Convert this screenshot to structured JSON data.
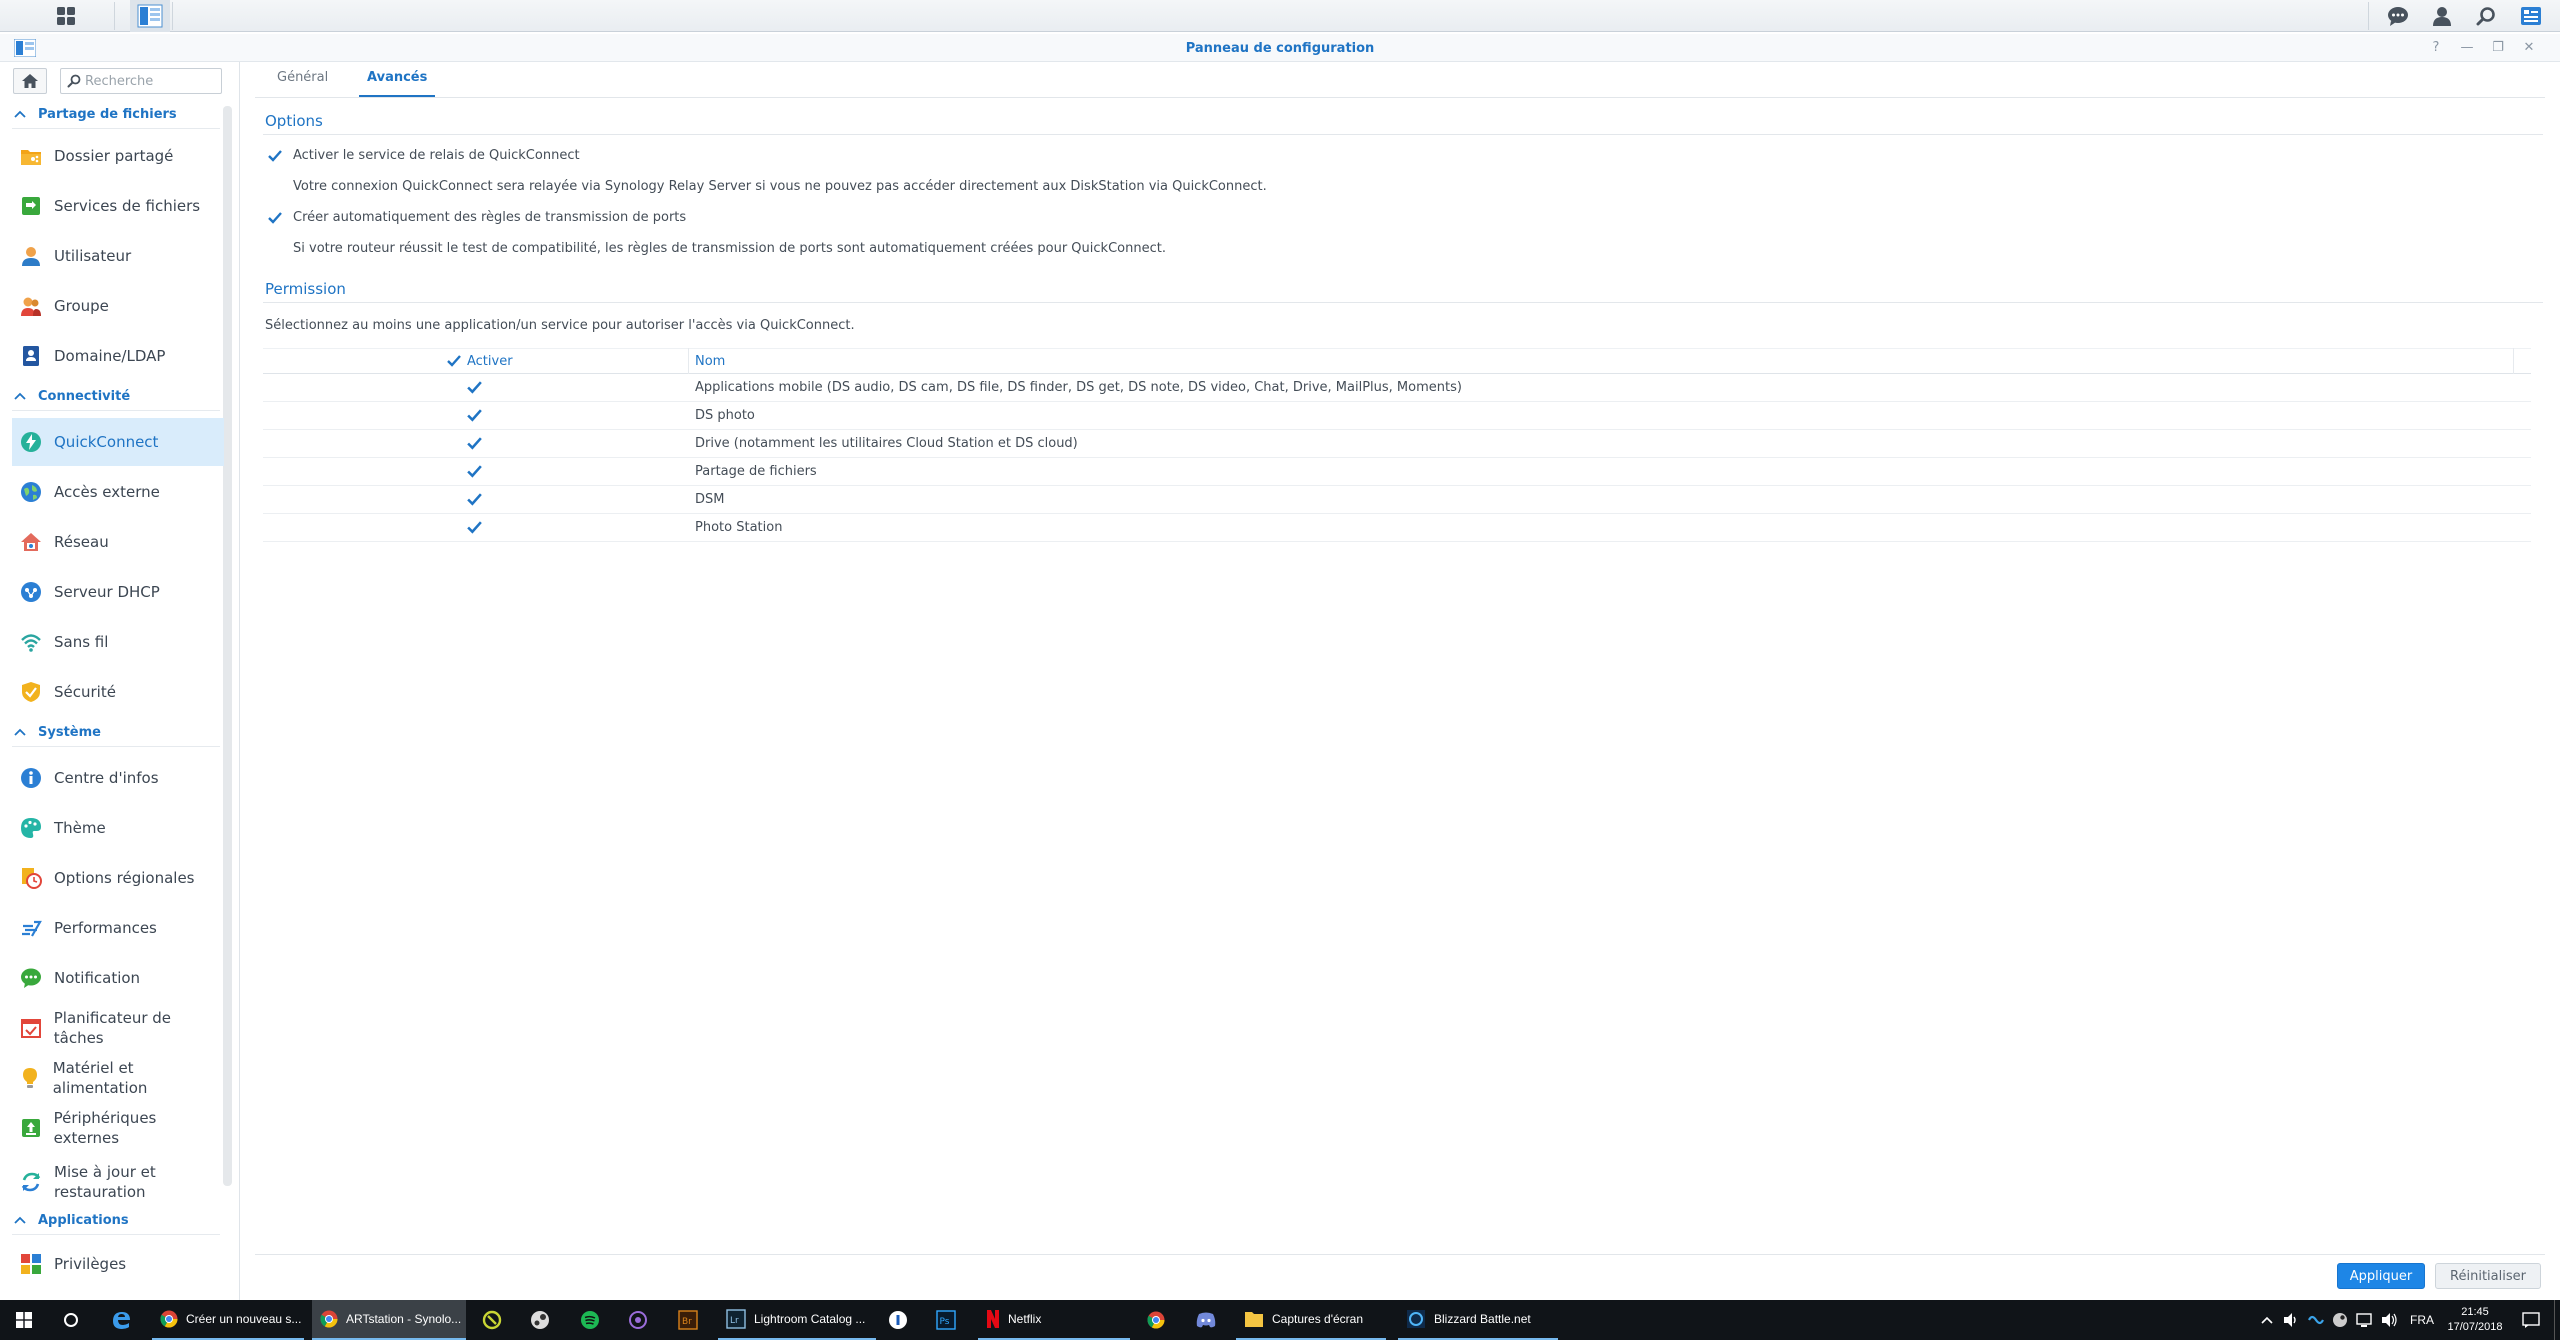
{
  "window": {
    "title": "Panneau de configuration"
  },
  "search": {
    "placeholder": "Recherche"
  },
  "sidebar": {
    "sections": [
      {
        "label": "Partage de fichiers"
      },
      {
        "label": "Connectivité"
      },
      {
        "label": "Système"
      },
      {
        "label": "Applications"
      }
    ],
    "items": [
      {
        "label": "Dossier partagé",
        "icon": "shared-folder-icon"
      },
      {
        "label": "Services de fichiers",
        "icon": "file-services-icon"
      },
      {
        "label": "Utilisateur",
        "icon": "user-icon"
      },
      {
        "label": "Groupe",
        "icon": "group-icon"
      },
      {
        "label": "Domaine/LDAP",
        "icon": "domain-ldap-icon"
      },
      {
        "label": "QuickConnect",
        "icon": "quickconnect-icon",
        "active": true
      },
      {
        "label": "Accès externe",
        "icon": "external-access-icon"
      },
      {
        "label": "Réseau",
        "icon": "network-icon"
      },
      {
        "label": "Serveur DHCP",
        "icon": "dhcp-server-icon"
      },
      {
        "label": "Sans fil",
        "icon": "wireless-icon"
      },
      {
        "label": "Sécurité",
        "icon": "security-icon"
      },
      {
        "label": "Centre d'infos",
        "icon": "info-center-icon"
      },
      {
        "label": "Thème",
        "icon": "theme-icon"
      },
      {
        "label": "Options régionales",
        "icon": "regional-options-icon"
      },
      {
        "label": "Performances",
        "icon": "performance-icon"
      },
      {
        "label": "Notification",
        "icon": "notification-icon"
      },
      {
        "label": "Planificateur de tâches",
        "icon": "task-scheduler-icon"
      },
      {
        "label": "Matériel et alimentation",
        "icon": "hardware-power-icon"
      },
      {
        "label": "Périphériques externes",
        "icon": "external-devices-icon"
      },
      {
        "label": "Mise à jour et restauration",
        "icon": "update-restore-icon"
      },
      {
        "label": "Privilèges",
        "icon": "privileges-icon"
      }
    ]
  },
  "tabs": [
    {
      "label": "Général"
    },
    {
      "label": "Avancés",
      "active": true
    }
  ],
  "options": {
    "title": "Options",
    "relay": {
      "label": "Activer le service de relais de QuickConnect",
      "checked": true,
      "description": "Votre connexion QuickConnect sera relayée via Synology Relay Server si vous ne pouvez pas accéder directement aux DiskStation via QuickConnect."
    },
    "port_forward": {
      "label": "Créer automatiquement des règles de transmission de ports",
      "checked": true,
      "description": "Si votre routeur réussit le test de compatibilité, les règles de transmission de ports sont automatiquement créées pour QuickConnect."
    }
  },
  "permission": {
    "title": "Permission",
    "description": "Sélectionnez au moins une application/un service pour autoriser l'accès via QuickConnect.",
    "columns": {
      "enable": "Activer",
      "name": "Nom"
    },
    "rows": [
      {
        "name": "Applications mobile (DS audio, DS cam, DS file, DS finder, DS get, DS note, DS video, Chat, Drive, MailPlus, Moments)",
        "enabled": true
      },
      {
        "name": "DS photo",
        "enabled": true
      },
      {
        "name": "Drive (notamment les utilitaires Cloud Station et DS cloud)",
        "enabled": true
      },
      {
        "name": "Partage de fichiers",
        "enabled": true
      },
      {
        "name": "DSM",
        "enabled": true
      },
      {
        "name": "Photo Station",
        "enabled": true
      }
    ]
  },
  "buttons": {
    "apply": "Appliquer",
    "reset": "Réinitialiser"
  },
  "taskbar": {
    "items": [
      {
        "label": "Créer un nouveau s...",
        "icon": "chrome-icon"
      },
      {
        "label": "ARTstation - Synolo...",
        "icon": "chrome-icon",
        "active": true
      },
      {
        "label": "Lightroom Catalog ...",
        "icon": "lightroom-icon"
      },
      {
        "label": "Netflix",
        "icon": "netflix-icon"
      },
      {
        "label": "Captures d'écran",
        "icon": "folder-icon"
      },
      {
        "label": "Blizzard Battle.net",
        "icon": "battlenet-icon"
      }
    ],
    "language": "FRA",
    "time": "21:45",
    "date": "17/07/2018"
  },
  "colors": {
    "accent": "#1f74c4",
    "apply": "#1e86e6",
    "active_nav": "#d9ecfb",
    "taskbar": "#101418"
  }
}
